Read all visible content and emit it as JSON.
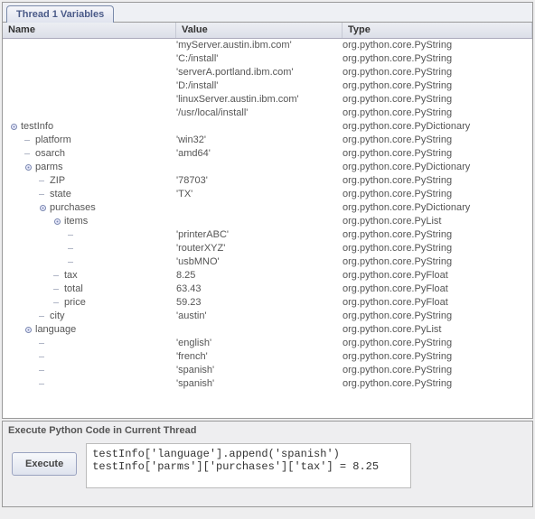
{
  "tab_label": "Thread 1 Variables",
  "columns": {
    "name": "Name",
    "value": "Value",
    "type": "Type"
  },
  "types": {
    "str": "org.python.core.PyString",
    "dict": "org.python.core.PyDictionary",
    "list": "org.python.core.PyList",
    "float": "org.python.core.PyFloat"
  },
  "rows": [
    {
      "depth": 3,
      "toggle": "",
      "name": "",
      "value": "'myServer.austin.ibm.com'",
      "type": "str"
    },
    {
      "depth": 3,
      "toggle": "",
      "name": "",
      "value": "'C:/install'",
      "type": "str"
    },
    {
      "depth": 3,
      "toggle": "",
      "name": "",
      "value": "'serverA.portland.ibm.com'",
      "type": "str"
    },
    {
      "depth": 3,
      "toggle": "",
      "name": "",
      "value": "'D:/install'",
      "type": "str"
    },
    {
      "depth": 3,
      "toggle": "",
      "name": "",
      "value": "'linuxServer.austin.ibm.com'",
      "type": "str"
    },
    {
      "depth": 3,
      "toggle": "",
      "name": "",
      "value": "'/usr/local/install'",
      "type": "str"
    },
    {
      "depth": 0,
      "toggle": "open",
      "name": "testInfo",
      "value": "",
      "type": "dict"
    },
    {
      "depth": 1,
      "toggle": "leaf",
      "name": "platform",
      "value": "'win32'",
      "type": "str"
    },
    {
      "depth": 1,
      "toggle": "leaf",
      "name": "osarch",
      "value": "'amd64'",
      "type": "str"
    },
    {
      "depth": 1,
      "toggle": "open",
      "name": "parms",
      "value": "",
      "type": "dict"
    },
    {
      "depth": 2,
      "toggle": "leaf",
      "name": "ZIP",
      "value": "'78703'",
      "type": "str"
    },
    {
      "depth": 2,
      "toggle": "leaf",
      "name": "state",
      "value": "'TX'",
      "type": "str"
    },
    {
      "depth": 2,
      "toggle": "open",
      "name": "purchases",
      "value": "",
      "type": "dict"
    },
    {
      "depth": 3,
      "toggle": "open",
      "name": "items",
      "value": "",
      "type": "list"
    },
    {
      "depth": 4,
      "toggle": "leaf",
      "name": "",
      "value": "'printerABC'",
      "type": "str"
    },
    {
      "depth": 4,
      "toggle": "leaf",
      "name": "",
      "value": "'routerXYZ'",
      "type": "str"
    },
    {
      "depth": 4,
      "toggle": "leaf",
      "name": "",
      "value": "'usbMNO'",
      "type": "str"
    },
    {
      "depth": 3,
      "toggle": "leaf",
      "name": "tax",
      "value": "8.25",
      "type": "float"
    },
    {
      "depth": 3,
      "toggle": "leaf",
      "name": "total",
      "value": "63.43",
      "type": "float"
    },
    {
      "depth": 3,
      "toggle": "leaf",
      "name": "price",
      "value": "59.23",
      "type": "float"
    },
    {
      "depth": 2,
      "toggle": "leaf",
      "name": "city",
      "value": "'austin'",
      "type": "str"
    },
    {
      "depth": 1,
      "toggle": "open",
      "name": "language",
      "value": "",
      "type": "list"
    },
    {
      "depth": 2,
      "toggle": "leaf",
      "name": "",
      "value": "'english'",
      "type": "str"
    },
    {
      "depth": 2,
      "toggle": "leaf",
      "name": "",
      "value": "'french'",
      "type": "str"
    },
    {
      "depth": 2,
      "toggle": "leaf",
      "name": "",
      "value": "'spanish'",
      "type": "str"
    },
    {
      "depth": 2,
      "toggle": "leaf",
      "name": "",
      "value": "'spanish'",
      "type": "str"
    }
  ],
  "exec_panel": {
    "title": "Execute Python Code in Current Thread",
    "button": "Execute",
    "code": "testInfo['language'].append('spanish')\ntestInfo['parms']['purchases']['tax'] = 8.25"
  }
}
